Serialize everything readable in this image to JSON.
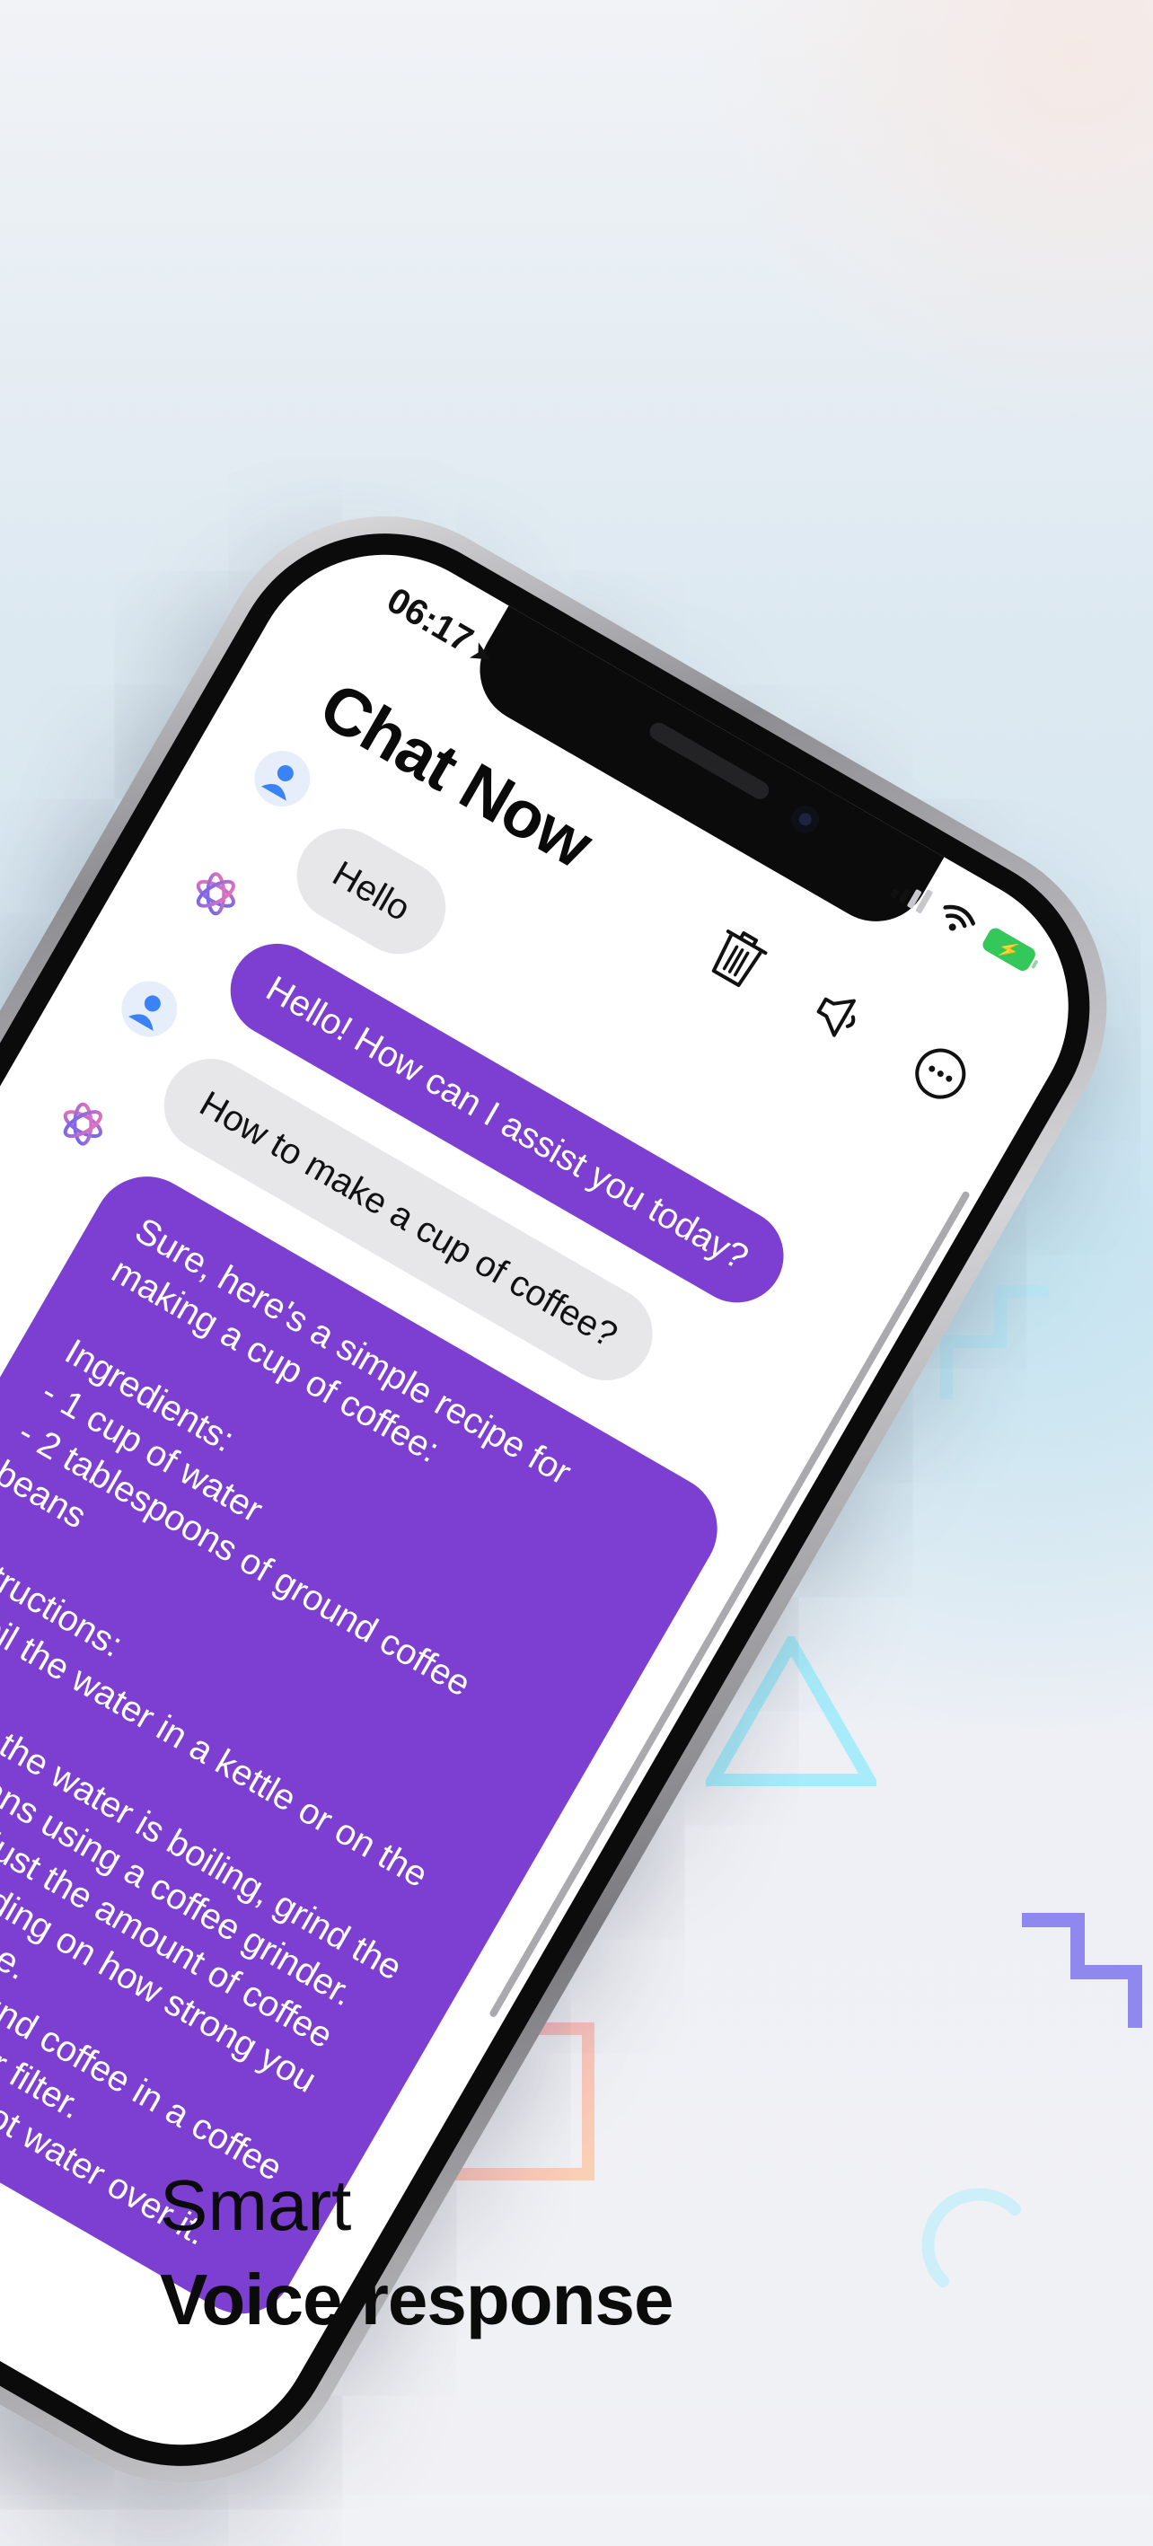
{
  "status_bar": {
    "time": "06:17",
    "location_glyph": "➤",
    "battery_glyph": "⚡"
  },
  "app": {
    "title": "Chat Now"
  },
  "toolbar": {
    "icons": [
      "trash-icon",
      "speaker-icon",
      "more-icon"
    ]
  },
  "messages": [
    {
      "role": "user",
      "text": "Hello"
    },
    {
      "role": "bot",
      "text": "Hello! How can I assist you today?"
    },
    {
      "role": "user",
      "text": "How to make a cup of coffee?"
    },
    {
      "role": "bot",
      "text": "Sure, here's a simple recipe for making a cup of coffee:\n\nIngredients:\n- 1 cup of water\n- 2 tablespoons of ground coffee beans\n\nInstructions:\n1. Boil the water in a kettle or on the stove.\n2. While the water is boiling, grind the coffee beans using a coffee grinder. You can adjust the amount of coffee beans depending on how strong you want your coffee.\n3. Place the ground coffee in a coffee filter or a pour-over filter.\n4. Slowly pour the hot water over it."
    }
  ],
  "caption": {
    "line1": "Smart",
    "line2": "Voice response"
  },
  "colors": {
    "accent": "#7c3fd2",
    "user_bubble": "#e7e7ea",
    "deco_teal": "#a8ecfb",
    "deco_indigo": "#8e88ef",
    "deco_pink": "#f8b9c2"
  }
}
